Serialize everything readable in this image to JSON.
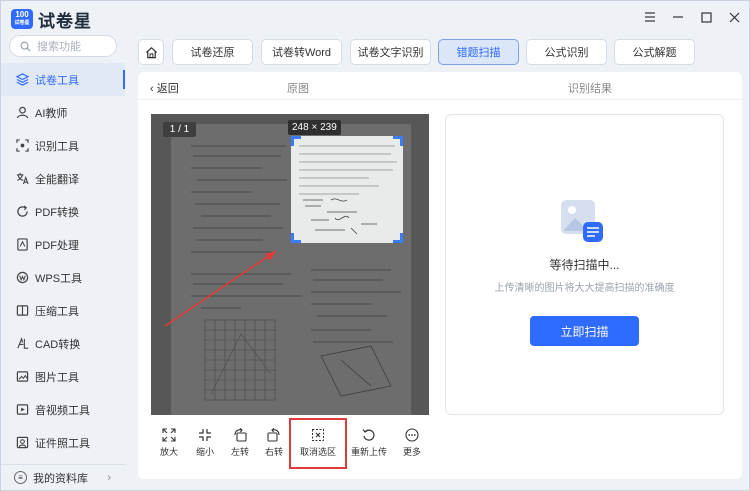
{
  "app": {
    "title": "试卷星",
    "badge_top": "100",
    "badge_bottom": "试卷星"
  },
  "search": {
    "placeholder": "搜索功能"
  },
  "sidebar": {
    "items": [
      {
        "label": "试卷工具",
        "icon": "layers-icon",
        "active": true
      },
      {
        "label": "AI教师",
        "icon": "teacher-icon"
      },
      {
        "label": "识别工具",
        "icon": "scan-icon"
      },
      {
        "label": "全能翻译",
        "icon": "translate-icon"
      },
      {
        "label": "PDF转换",
        "icon": "convert-icon"
      },
      {
        "label": "PDF处理",
        "icon": "pdf-icon"
      },
      {
        "label": "WPS工具",
        "icon": "wps-icon"
      },
      {
        "label": "压缩工具",
        "icon": "compress-icon"
      },
      {
        "label": "CAD转换",
        "icon": "cad-icon"
      },
      {
        "label": "图片工具",
        "icon": "image-icon"
      },
      {
        "label": "音视频工具",
        "icon": "video-icon"
      },
      {
        "label": "证件照工具",
        "icon": "id-photo-icon"
      }
    ],
    "library": "我的资料库"
  },
  "tabs": [
    {
      "label": "试卷还原"
    },
    {
      "label": "试卷转Word"
    },
    {
      "label": "试卷文字识别"
    },
    {
      "label": "错题扫描",
      "active": true
    },
    {
      "label": "公式识别"
    },
    {
      "label": "公式解题"
    }
  ],
  "panel": {
    "back": "返回",
    "original_label": "原图",
    "result_label": "识别结果",
    "page_indicator": "1 / 1",
    "selection_size": "248 × 239",
    "waiting": "等待扫描中...",
    "hint": "上传清晰的图片将大大提高扫描的准确度",
    "scan_button": "立即扫描"
  },
  "toolbar": [
    {
      "label": "放大",
      "icon": "zoom-in-icon"
    },
    {
      "label": "缩小",
      "icon": "zoom-out-icon"
    },
    {
      "label": "左转",
      "icon": "rotate-left-icon"
    },
    {
      "label": "右转",
      "icon": "rotate-right-icon"
    },
    {
      "label": "取消选区",
      "icon": "cancel-selection-icon"
    },
    {
      "label": "重新上传",
      "icon": "reupload-icon"
    },
    {
      "label": "更多",
      "icon": "more-icon"
    }
  ],
  "colors": {
    "accent": "#2f6bff",
    "highlight": "#e03a3a"
  }
}
